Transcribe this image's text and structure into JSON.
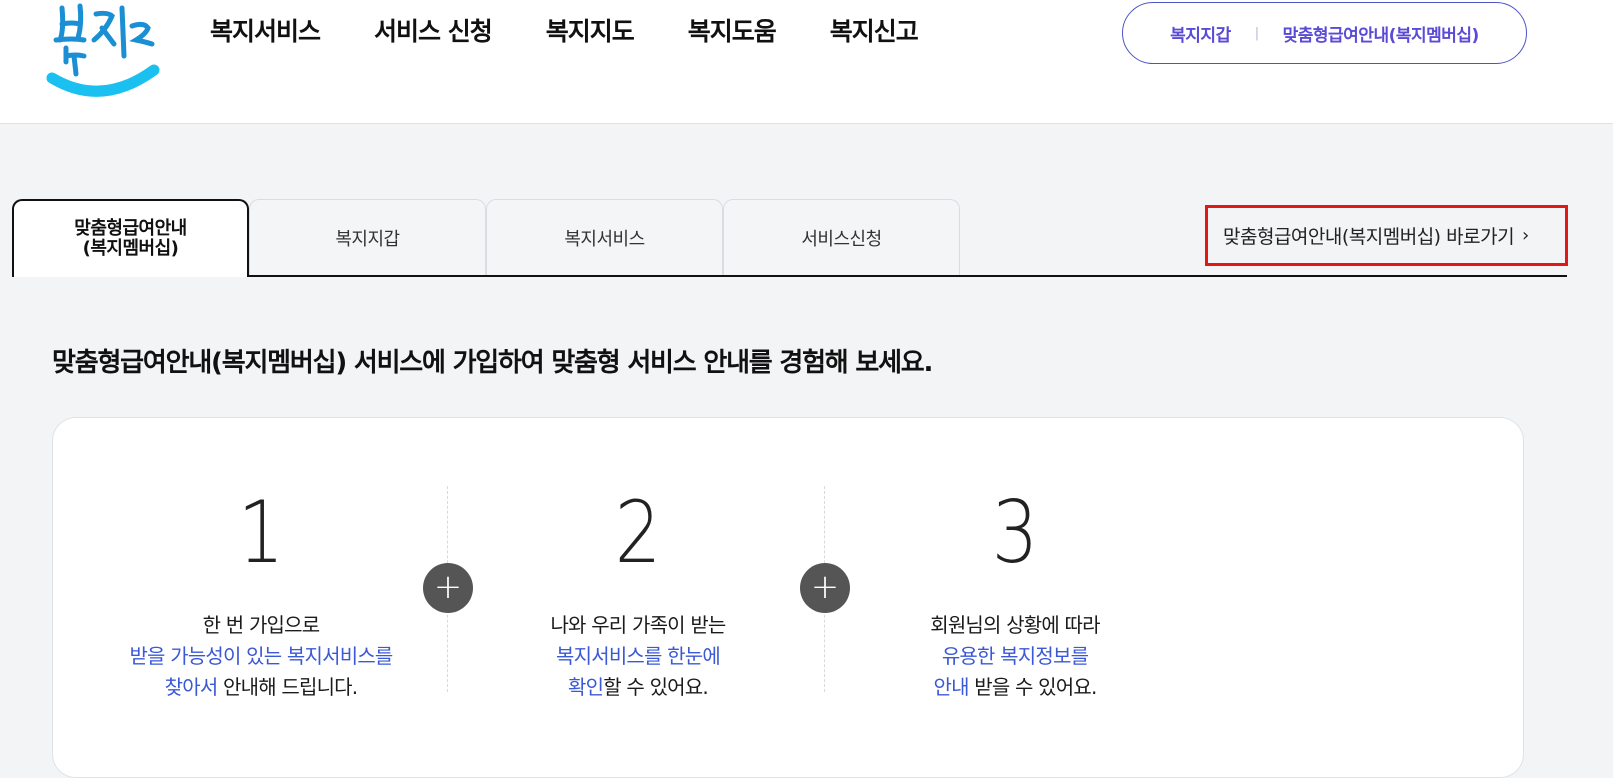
{
  "header": {
    "gnb": [
      "복지서비스",
      "서비스 신청",
      "복지지도",
      "복지도움",
      "복지신고"
    ],
    "util": {
      "wallet": "복지지갑",
      "membership": "맞춤형급여안내(복지멤버십)"
    }
  },
  "tabs": {
    "items": [
      {
        "label_line1": "맞춤형급여안내",
        "label_line2": "(복지멤버십)"
      },
      {
        "label": "복지지갑"
      },
      {
        "label": "복지서비스"
      },
      {
        "label": "서비스신청"
      }
    ],
    "shortcut": "맞춤형급여안내(복지멤버십) 바로가기"
  },
  "headline": "맞춤형급여안내(복지멤버십) 서비스에 가입하여 맞춤형 서비스 안내를 경험해 보세요.",
  "steps": [
    {
      "num": "1",
      "line1": "한 번 가입으로",
      "line2_blue": "받을 가능성이 있는 복지서비스를",
      "line3_blue": "찾아서",
      "line3_rest": " 안내해 드립니다."
    },
    {
      "num": "2",
      "line1": "나와 우리 가족이 받는",
      "line2_blue": "복지서비스를 한눈에",
      "line3_blue": "확인",
      "line3_rest": "할 수 있어요."
    },
    {
      "num": "3",
      "line1": "회원님의 상황에 따라",
      "line2_blue": "유용한 복지정보를",
      "line3_blue": "안내",
      "line3_rest": " 받을 수 있어요."
    }
  ],
  "colors": {
    "accent_blue": "#3b58d6",
    "brand_purple": "#5b4ad6",
    "highlight_red": "#e01818"
  }
}
